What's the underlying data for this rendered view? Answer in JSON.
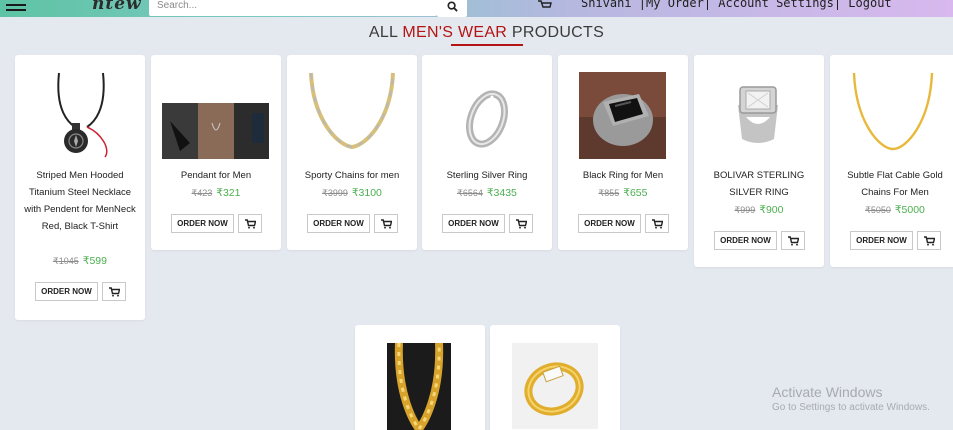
{
  "header": {
    "logo": "ntew",
    "search_placeholder": "Search...",
    "nav_links": "Shivani |My Order| Account Settings| Logout"
  },
  "heading": {
    "prefix": "ALL ",
    "accent": "MEN'S WEAR",
    "suffix": " PRODUCTS"
  },
  "buttons": {
    "order_label": "ORDER NOW"
  },
  "products": [
    {
      "name": "Striped Men Hooded Titanium Steel Necklace with Pendent for MenNeck Red, Black T-Shirt",
      "old_price": "₹1045",
      "new_price": "₹599"
    },
    {
      "name": "Pendant for Men",
      "old_price": "₹423",
      "new_price": "₹321"
    },
    {
      "name": "Sporty Chains for men",
      "old_price": "₹3999",
      "new_price": "₹3100"
    },
    {
      "name": "Sterling Silver Ring",
      "old_price": "₹6564",
      "new_price": "₹3435"
    },
    {
      "name": "Black Ring for Men",
      "old_price": "₹855",
      "new_price": "₹655"
    },
    {
      "name": "BOLIVAR STERLING SILVER RING",
      "old_price": "₹999",
      "new_price": "₹900"
    },
    {
      "name": "Subtle Flat Cable Gold Chains For Men",
      "old_price": "₹5050",
      "new_price": "₹5000"
    }
  ],
  "watermark": {
    "title": "Activate Windows",
    "subtitle": "Go to Settings to activate Windows."
  },
  "colors": {
    "accent": "#b41414",
    "price_new": "#4caf50",
    "background": "#e4e9ef"
  }
}
